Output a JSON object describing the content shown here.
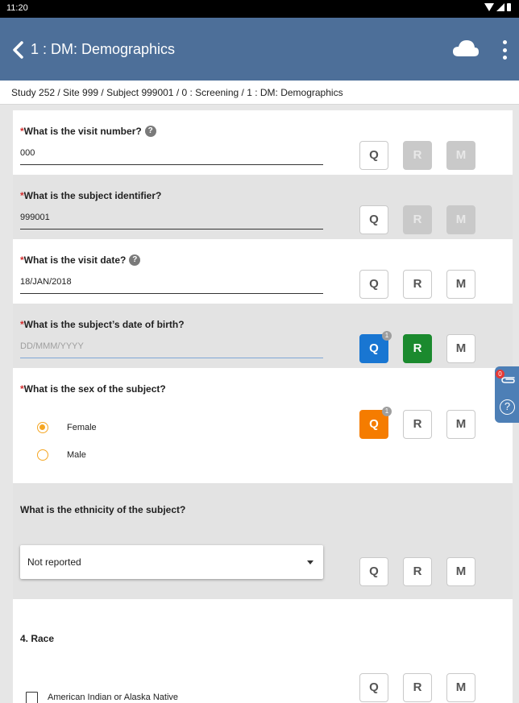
{
  "status_bar": {
    "time": "11:20"
  },
  "app_bar": {
    "title": "1 : DM: Demographics"
  },
  "breadcrumb": "Study 252 / Site 999 / Subject 999001 / 0 : Screening / 1 : DM: Demographics",
  "buttons": {
    "query": "Q",
    "review": "R",
    "manual": "M"
  },
  "help_glyph": "?",
  "required_mark": "*",
  "questions": [
    {
      "label": "What is the visit number?",
      "value": "000",
      "required": true,
      "help": true
    },
    {
      "label": "What is the subject identifier?",
      "value": "999001",
      "required": true,
      "help": false
    },
    {
      "label": "What is the visit date?",
      "value": "18/JAN/2018",
      "required": true,
      "help": true
    },
    {
      "label": "What is the subject’s date of birth?",
      "placeholder": "DD/MMM/YYYY",
      "required": true,
      "help": false,
      "query_count": "1"
    },
    {
      "label": "What is the sex of the subject?",
      "required": true,
      "options": [
        "Female",
        "Male"
      ],
      "selected": "Female",
      "query_count": "1"
    },
    {
      "label": "What is the ethnicity of the subject?",
      "required": false,
      "selected_value": "Not reported"
    },
    {
      "label": "4. Race",
      "required": false,
      "options": [
        "American Indian or Alaska Native"
      ]
    }
  ],
  "side_panel": {
    "attachment_count": "0",
    "help": "?"
  },
  "colors": {
    "app_bar": "#4d6f99",
    "required": "#d32f2f",
    "query_open": "#1976d2",
    "reviewed": "#1b8a2e",
    "query_answered": "#f57c00",
    "radio": "#f5a623"
  }
}
